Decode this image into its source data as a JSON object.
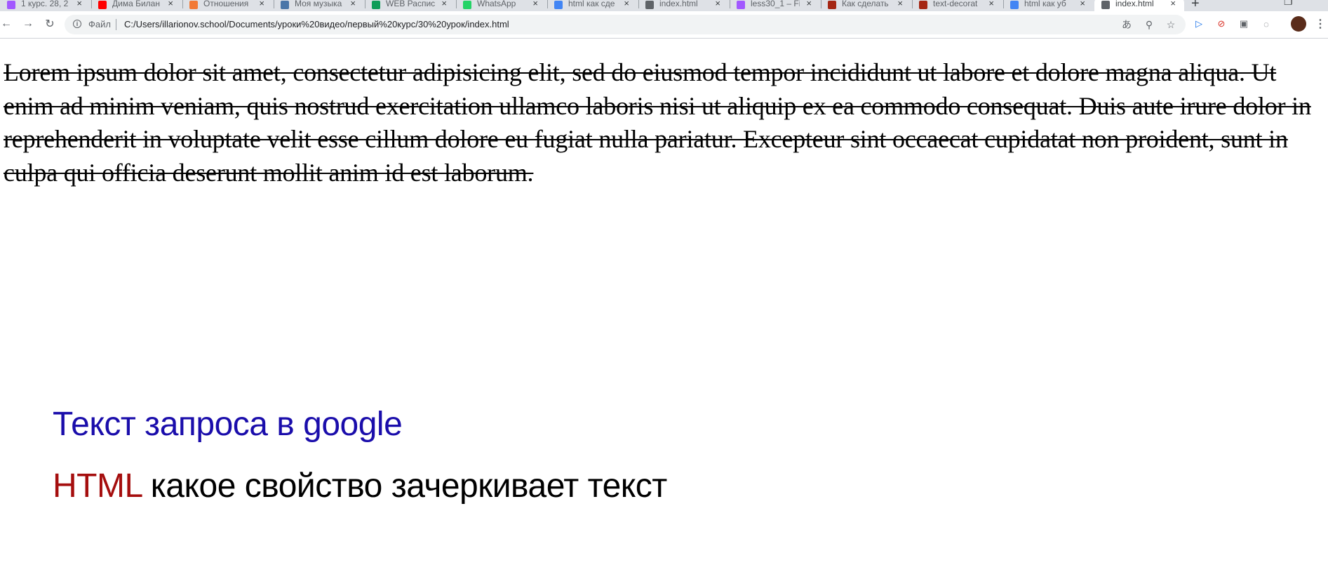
{
  "tabs": [
    {
      "title": "1 курс. 28, 2",
      "favicon": "figma-icon",
      "color": "#a259ff"
    },
    {
      "title": "Дима Билан",
      "favicon": "youtube-icon",
      "color": "#ff0000"
    },
    {
      "title": "Отношения",
      "favicon": "orange-stack-icon",
      "color": "#f27a36"
    },
    {
      "title": "Моя музыка",
      "favicon": "vk-icon",
      "color": "#4a76a8"
    },
    {
      "title": "WEB Распис",
      "favicon": "sheets-icon",
      "color": "#0f9d58"
    },
    {
      "title": "WhatsApp",
      "favicon": "whatsapp-icon",
      "color": "#25d366"
    },
    {
      "title": "html как сде",
      "favicon": "google-icon",
      "color": "#4285f4"
    },
    {
      "title": "index.html",
      "favicon": "globe-icon",
      "color": "#5f6368"
    },
    {
      "title": "less30_1 – Fi",
      "favicon": "figma-icon",
      "color": "#a259ff"
    },
    {
      "title": "Как сделать",
      "favicon": "gift-icon",
      "color": "#a52714"
    },
    {
      "title": "text-decorat",
      "favicon": "gift-icon",
      "color": "#a52714"
    },
    {
      "title": "html как уб",
      "favicon": "google-icon",
      "color": "#4285f4"
    },
    {
      "title": "index.html",
      "favicon": "globe-icon",
      "color": "#5f6368",
      "active": true
    }
  ],
  "toolbar": {
    "back_icon": "←",
    "forward_icon": "→",
    "reload_icon": "↻",
    "info_icon": "i",
    "scheme": "Файл",
    "url": "C:/Users/illarionov.school/Documents/уроки%20видео/первый%20курс/30%20урок/index.html",
    "translate_icon": "あ",
    "zoom_icon": "⚲",
    "star_icon": "☆",
    "new_tab_icon": "+",
    "close_glyph": "×"
  },
  "extensions": [
    {
      "name": "send-extension-icon",
      "glyph": "▷",
      "color": "#1a73e8"
    },
    {
      "name": "adblock-extension-icon",
      "glyph": "⊘",
      "color": "#d93025"
    },
    {
      "name": "camera-extension-icon",
      "glyph": "▣",
      "color": "#5f6368"
    },
    {
      "name": "circle-extension-icon",
      "glyph": "◌",
      "color": "#5f6368"
    }
  ],
  "page": {
    "lorem": "Lorem ipsum dolor sit amet, consectetur adipisicing elit, sed do eiusmod tempor incididunt ut labore et dolore magna aliqua. Ut enim ad minim veniam, quis nostrud exercitation ullamco laboris nisi ut aliquip ex ea commodo consequat. Duis aute irure dolor in reprehenderit in voluptate velit esse cillum dolore eu fugiat nulla pariatur. Excepteur sint occaecat cupidatat non proident, sunt in culpa qui officia deserunt mollit anim id est laborum.",
    "query_text": "Текст запроса в google",
    "snippet_highlight": "HTML",
    "snippet_rest": " какое свойство зачеркивает текст"
  },
  "colors": {
    "query": "#1a0dab",
    "highlight": "#a50e0e",
    "tabstrip": "#dee1e6",
    "omnibox": "#f1f3f4"
  }
}
